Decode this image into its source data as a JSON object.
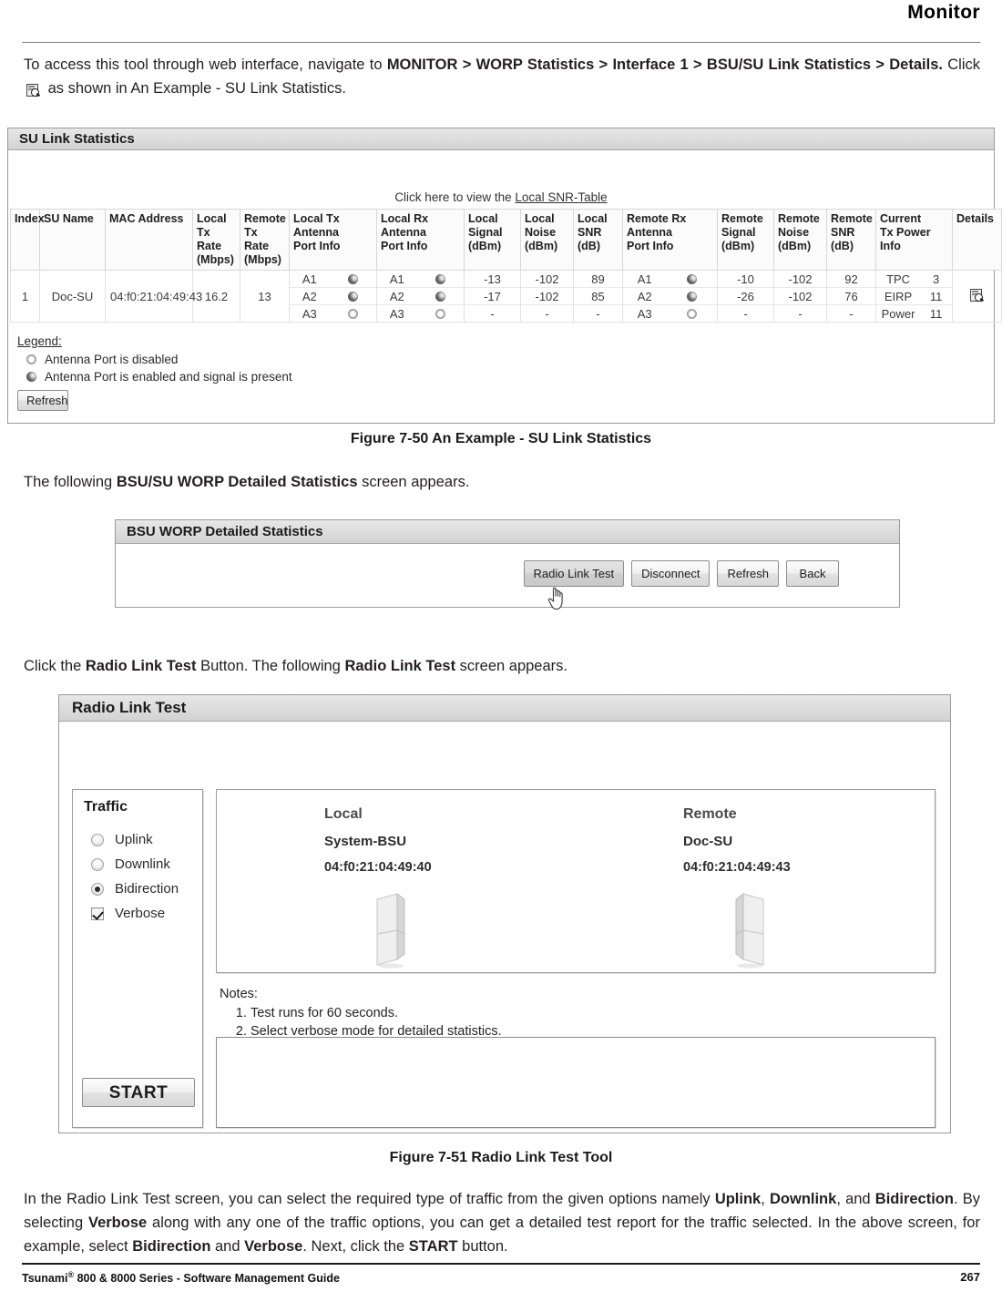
{
  "running_header": {
    "title": "Monitor"
  },
  "intro": {
    "line1_pre": "To access this tool through web interface, navigate to ",
    "line1_bold": "MONITOR > WORP Statistics > Interface 1 > BSU/SU Link Statistics > Details.",
    "line1_mid": " Click ",
    "line1_post": " as shown in An Example - SU Link Statistics."
  },
  "su_panel": {
    "title": "SU Link Statistics",
    "snr_link_pre": "Click here to view the ",
    "snr_link": "Local SNR-Table",
    "headers": [
      "Index",
      "SU Name",
      "MAC Address",
      "Local\nTx Rate\n(Mbps)",
      "Remote\nTx Rate\n(Mbps)",
      "Local Tx\nAntenna\nPort Info",
      "Local Rx\nAntenna\nPort Info",
      "Local\nSignal\n(dBm)",
      "Local\nNoise\n(dBm)",
      "Local\nSNR\n(dB)",
      "Remote Rx\nAntenna\nPort Info",
      "Remote\nSignal\n(dBm)",
      "Remote\nNoise\n(dBm)",
      "Remote\nSNR\n(dB)",
      "Current\nTx Power\nInfo",
      "Details"
    ],
    "row": {
      "index": "1",
      "su_name": "Doc-SU",
      "mac_address": "04:f0:21:04:49:43",
      "local_tx_rate": "16.2",
      "remote_tx_rate": "13",
      "local_tx_antenna": [
        {
          "port": "A1",
          "state": "enabled"
        },
        {
          "port": "A2",
          "state": "enabled"
        },
        {
          "port": "A3",
          "state": "disabled"
        }
      ],
      "local_rx_antenna": [
        {
          "port": "A1",
          "state": "enabled"
        },
        {
          "port": "A2",
          "state": "enabled"
        },
        {
          "port": "A3",
          "state": "disabled"
        }
      ],
      "local_signal": [
        "-13",
        "-17",
        "-"
      ],
      "local_noise": [
        "-102",
        "-102",
        "-"
      ],
      "local_snr": [
        "89",
        "85",
        "-"
      ],
      "remote_rx_antenna": [
        {
          "port": "A1",
          "state": "enabled"
        },
        {
          "port": "A2",
          "state": "enabled"
        },
        {
          "port": "A3",
          "state": "disabled"
        }
      ],
      "remote_signal": [
        "-10",
        "-26",
        "-"
      ],
      "remote_noise": [
        "-102",
        "-102",
        "-"
      ],
      "remote_snr": [
        "92",
        "76",
        "-"
      ],
      "current_tx_power": [
        {
          "key": "TPC",
          "value": "3"
        },
        {
          "key": "EIRP",
          "value": "11"
        },
        {
          "key": "Power",
          "value": "11"
        }
      ],
      "details_icon": "details-magnifier-icon"
    },
    "legend": {
      "title": "Legend:",
      "items": [
        {
          "icon": "antenna-port-disabled-icon",
          "label": "Antenna Port is disabled"
        },
        {
          "icon": "antenna-port-enabled-icon",
          "label": "Antenna Port is enabled and signal is present"
        }
      ]
    },
    "refresh_label": "Refresh"
  },
  "caption_1": "Figure 7-50 An Example - SU Link Statistics",
  "mid_text": {
    "pre": "The following ",
    "bold": "BSU/SU WORP Detailed Statistics",
    "post": " screen appears."
  },
  "worp_panel": {
    "title": "BSU WORP Detailed Statistics",
    "buttons": [
      "Radio Link Test",
      "Disconnect",
      "Refresh",
      "Back"
    ]
  },
  "rlt_intro": {
    "pre": "Click the ",
    "bold1": "Radio Link Test",
    "mid": " Button. The following ",
    "bold2": "Radio Link Test",
    "post": " screen appears."
  },
  "rlt_panel": {
    "title": "Radio Link Test",
    "traffic_title": "Traffic",
    "options": [
      {
        "label": "Uplink",
        "type": "radio",
        "selected": false
      },
      {
        "label": "Downlink",
        "type": "radio",
        "selected": false
      },
      {
        "label": "Bidirection",
        "type": "radio",
        "selected": true
      },
      {
        "label": "Verbose",
        "type": "checkbox",
        "selected": true
      }
    ],
    "start_label": "START",
    "local": {
      "label": "Local",
      "name": "System-BSU",
      "mac": "04:f0:21:04:49:40"
    },
    "remote": {
      "label": "Remote",
      "name": "Doc-SU",
      "mac": "04:f0:21:04:49:43"
    },
    "notes_heading": "Notes:",
    "notes": [
      "Test runs for 60 seconds.",
      "Select verbose mode for detailed statistics."
    ],
    "output_value": ""
  },
  "caption_2": "Figure 7-51 Radio Link Test Tool",
  "closing": {
    "p1": "In the Radio Link Test screen, you can select the required type of traffic from the given options namely ",
    "b1": "Uplink",
    "s1": ", ",
    "b2": "Downlink",
    "s2": ", and ",
    "b3": "Bidirection",
    "s3": ". By selecting ",
    "b4": "Verbose",
    "s4": " along with any one of the traffic options, you can get a detailed test report for the traffic selected. In the above screen, for example, select ",
    "b5": "Bidirection",
    "s5": " and ",
    "b6": "Verbose",
    "s6": ". Next, click the ",
    "b7": "START",
    "s7": " button."
  },
  "footer": {
    "left_pre": "Tsunami",
    "left_sup": "®",
    "left_post": " 800 & 8000 Series - Software Management Guide",
    "page": "267"
  }
}
